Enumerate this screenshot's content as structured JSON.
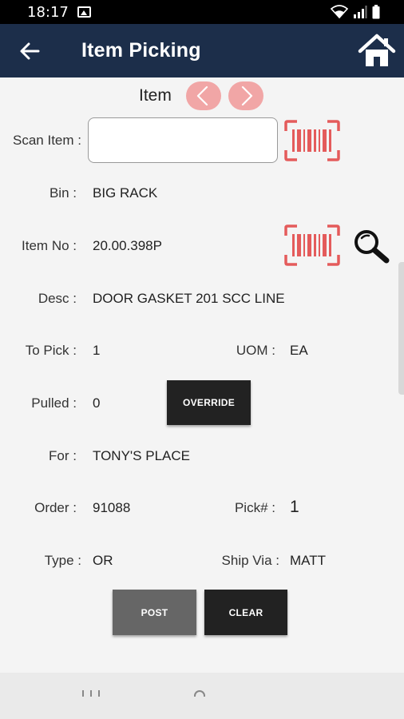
{
  "status": {
    "time": "18:17"
  },
  "header": {
    "title": "Item Picking"
  },
  "item_nav": {
    "label": "Item"
  },
  "form": {
    "scan_item": {
      "label": "Scan Item :",
      "value": "",
      "placeholder": ""
    },
    "bin": {
      "label": "Bin :",
      "value": "BIG RACK"
    },
    "item_no": {
      "label": "Item No :",
      "value": "20.00.398P"
    },
    "desc": {
      "label": "Desc :",
      "value": "DOOR GASKET 201 SCC LINE"
    },
    "to_pick": {
      "label": "To Pick :",
      "value": "1"
    },
    "uom": {
      "label": "UOM :",
      "value": "EA"
    },
    "pulled": {
      "label": "Pulled :",
      "value": "0"
    },
    "for": {
      "label": "For :",
      "value": "TONY'S PLACE"
    },
    "order": {
      "label": "Order :",
      "value": "91088"
    },
    "pick_num": {
      "label": "Pick# :",
      "value": "1"
    },
    "type": {
      "label": "Type :",
      "value": "OR"
    },
    "ship_via": {
      "label": "Ship Via :",
      "value": "MATT"
    }
  },
  "buttons": {
    "override": "OVERRIDE",
    "post": "POST",
    "clear": "CLEAR"
  },
  "colors": {
    "app_bar": "#1c2e4a",
    "accent_red": "#e45b5b",
    "nav_button": "#f1a6a6",
    "dark_button": "#222222",
    "gray_button": "#666666"
  },
  "icons": {
    "back": "arrow-left-icon",
    "home": "home-icon",
    "prev": "chevron-left-icon",
    "next": "chevron-right-icon",
    "barcode": "barcode-scan-icon",
    "search": "magnifier-icon"
  }
}
